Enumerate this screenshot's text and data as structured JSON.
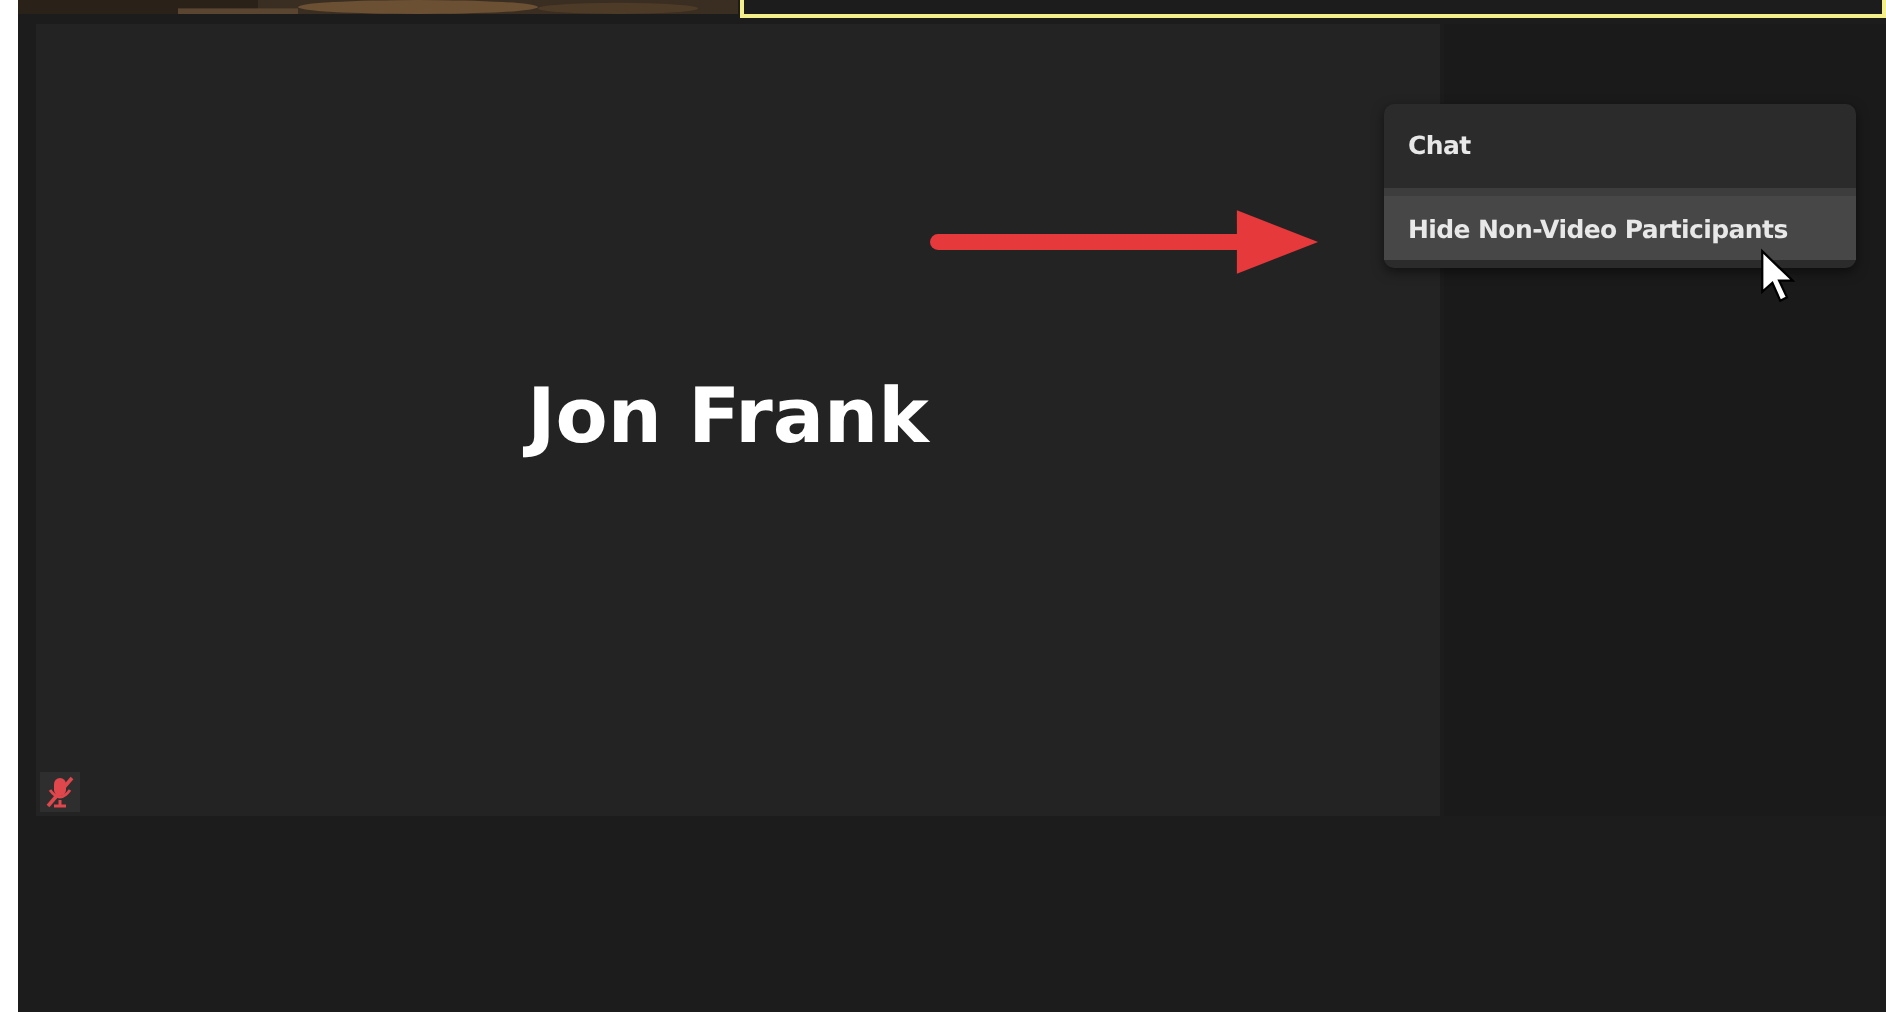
{
  "video_tile": {
    "name": "Jon Frank",
    "muted": true
  },
  "menu": {
    "items": [
      {
        "label": "Chat",
        "selected": false
      },
      {
        "label": "Hide Non-Video Participants",
        "selected": true
      }
    ]
  }
}
